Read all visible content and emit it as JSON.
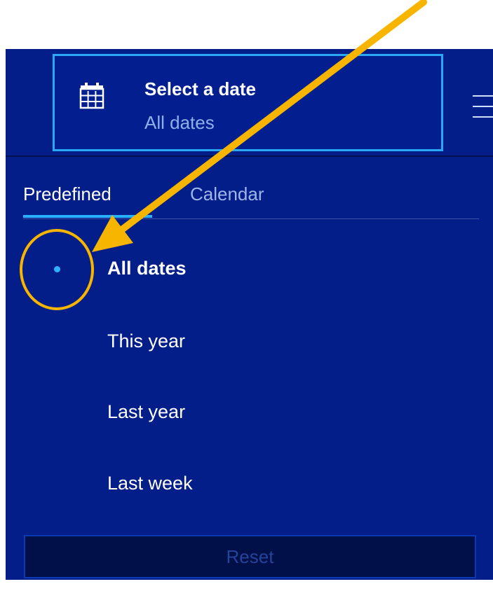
{
  "date_selector": {
    "title": "Select a date",
    "value": "All dates",
    "icon": "calendar-icon"
  },
  "menu": {
    "icon": "hamburger-menu-icon"
  },
  "tabs": [
    {
      "label": "Predefined",
      "active": true
    },
    {
      "label": "Calendar",
      "active": false
    }
  ],
  "options": [
    {
      "label": "All dates",
      "selected": true
    },
    {
      "label": "This year",
      "selected": false
    },
    {
      "label": "Last year",
      "selected": false
    },
    {
      "label": "Last week",
      "selected": false
    }
  ],
  "reset_label": "Reset",
  "colors": {
    "panel_background": "#031d89",
    "accent": "#2aa8f6",
    "annotation": "#f7b500"
  }
}
